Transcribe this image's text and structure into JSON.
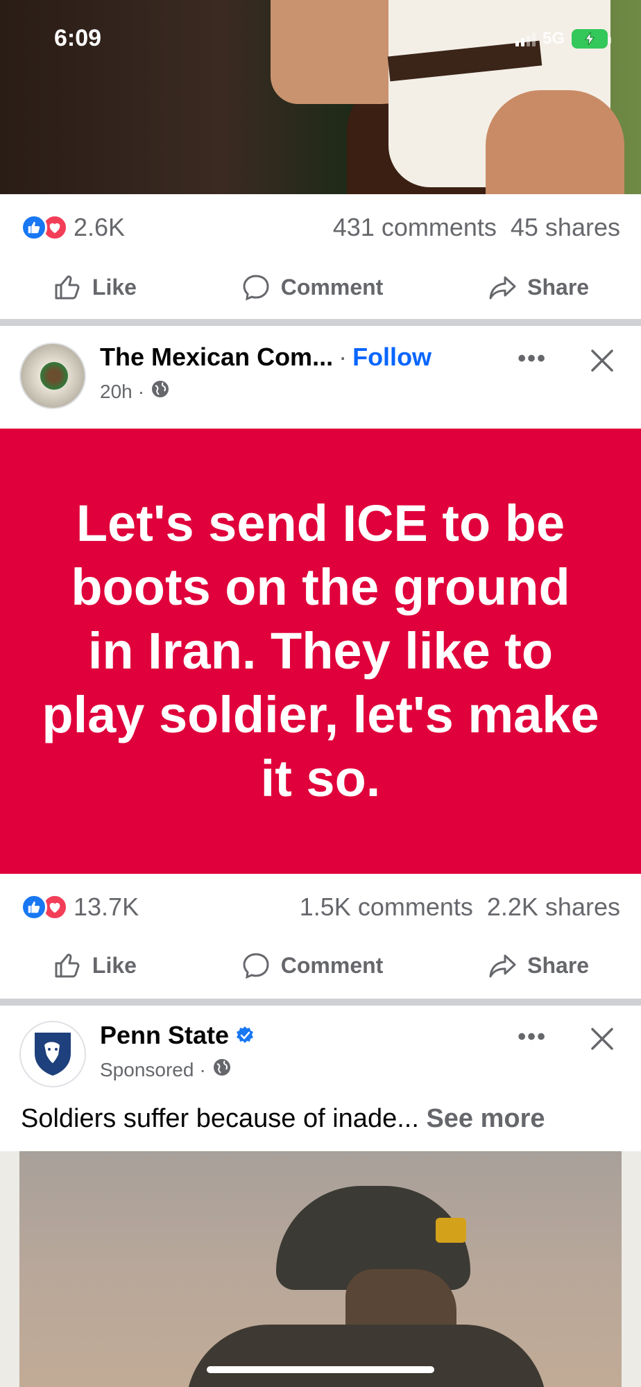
{
  "status_bar": {
    "time": "6:09",
    "network": "5G"
  },
  "post1": {
    "reaction_count": "2.6K",
    "comments": "431 comments",
    "shares": "45 shares"
  },
  "actions": {
    "like": "Like",
    "comment": "Comment",
    "share": "Share"
  },
  "post2": {
    "page_name": "The Mexican Com...",
    "follow": "Follow",
    "time": "20h",
    "body_text": "Let's send ICE to be boots on the ground in Iran. They like to play soldier, let's make it so.",
    "background_color": "#e0003b",
    "reaction_count": "13.7K",
    "comments": "1.5K comments",
    "shares": "2.2K shares"
  },
  "post3": {
    "page_name": "Penn State",
    "meta": "Sponsored",
    "caption": "Soldiers suffer because of inade...",
    "see_more": "See more"
  },
  "colors": {
    "accent": "#0866ff",
    "like": "#1877f2",
    "love": "#f33e58",
    "muted": "#65676b"
  }
}
